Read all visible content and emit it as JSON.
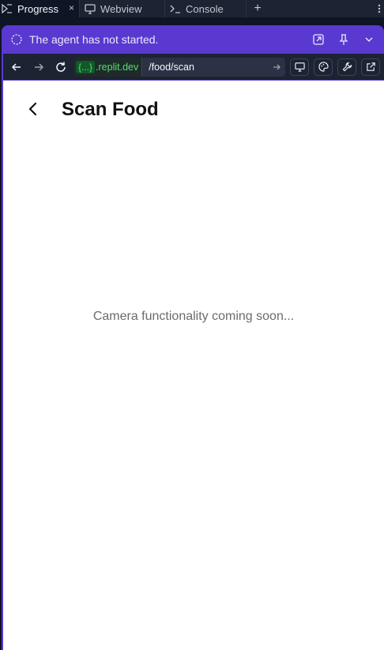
{
  "tabs": [
    {
      "label": "Progress",
      "icon": "progress-icon",
      "active": true
    },
    {
      "label": "Webview",
      "icon": "monitor-icon",
      "active": false
    },
    {
      "label": "Console",
      "icon": "terminal-icon",
      "active": false
    }
  ],
  "tab_close_symbol": "×",
  "tab_add_symbol": "+",
  "agent": {
    "status_text": "The agent has not started.",
    "icons": [
      "open-external-icon",
      "pin-icon",
      "chevron-down-icon"
    ]
  },
  "url": {
    "badge": "{...}",
    "host": ".replit.dev",
    "path": "/food/scan"
  },
  "app": {
    "title": "Scan Food",
    "message": "Camera functionality coming soon..."
  },
  "colors": {
    "frame_accent": "#5a39d0",
    "ide_background": "#0e1525",
    "domain_green": "#51e06b"
  }
}
